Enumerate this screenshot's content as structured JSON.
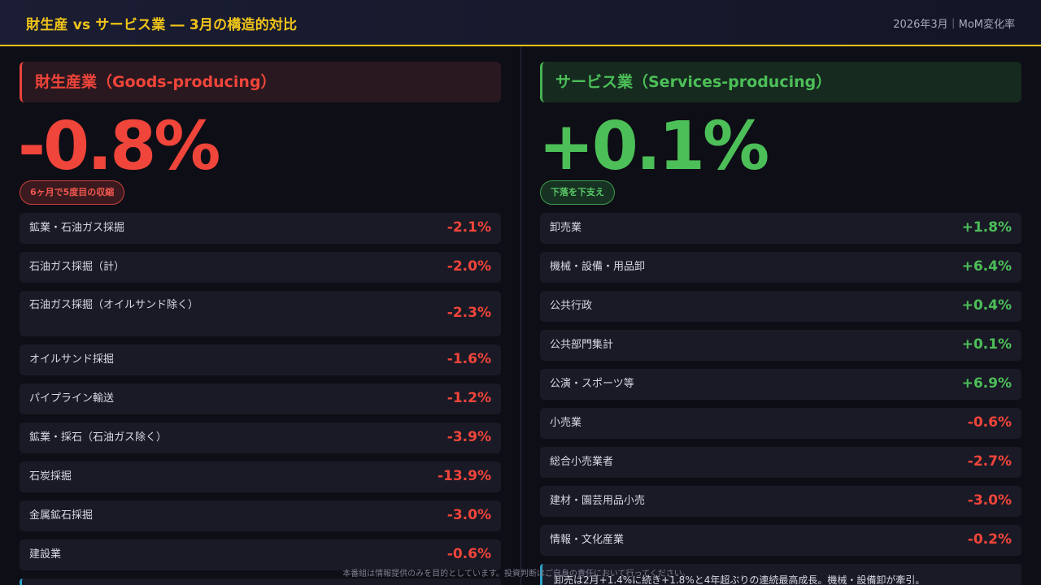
{
  "header": {
    "title": "財生産 vs サービス業 ― 3月の構造的対比",
    "meta": "2026年3月｜MoM変化率"
  },
  "goods": {
    "title": "財生産業（Goods-producing）",
    "value": "-0.8%",
    "badge": "6ヶ月で5度目の収縮",
    "items": [
      {
        "label": "鉱業・石油ガス採掘",
        "value": "-2.1%",
        "dir": "neg"
      },
      {
        "label": "石油ガス採掘（計）",
        "value": "-2.0%",
        "dir": "neg"
      },
      {
        "label": "石油ガス採掘（オイルサンド除く）",
        "value": "-2.3%",
        "dir": "neg"
      },
      {
        "label": "オイルサンド採掘",
        "value": "-1.6%",
        "dir": "neg"
      },
      {
        "label": "パイプライン輸送",
        "value": "-1.2%",
        "dir": "neg"
      },
      {
        "label": "鉱業・採石（石油ガス除く）",
        "value": "-3.9%",
        "dir": "neg"
      },
      {
        "label": "石炭採掘",
        "value": "-13.9%",
        "dir": "neg"
      },
      {
        "label": "金属鉱石採掘",
        "value": "-3.0%",
        "dir": "neg"
      },
      {
        "label": "建設業",
        "value": "-0.6%",
        "dir": "neg"
      }
    ]
  },
  "services": {
    "title": "サービス業（Services-producing）",
    "value": "+0.1%",
    "badge": "下落を下支え",
    "items": [
      {
        "label": "卸売業",
        "value": "+1.8%",
        "dir": "pos"
      },
      {
        "label": "機械・設備・用品卸",
        "value": "+6.4%",
        "dir": "pos"
      },
      {
        "label": "公共行政",
        "value": "+0.4%",
        "dir": "pos"
      },
      {
        "label": "公共部門集計",
        "value": "+0.1%",
        "dir": "pos"
      },
      {
        "label": "公演・スポーツ等",
        "value": "+6.9%",
        "dir": "pos"
      },
      {
        "label": "小売業",
        "value": "-0.6%",
        "dir": "neg"
      },
      {
        "label": "総合小売業者",
        "value": "-2.7%",
        "dir": "neg"
      },
      {
        "label": "建材・園芸用品小売",
        "value": "-3.0%",
        "dir": "neg"
      },
      {
        "label": "情報・文化産業",
        "value": "-0.2%",
        "dir": "neg"
      }
    ]
  },
  "note": "卸売は2月+1.4%に続き+1.8%と4年超ぶりの連続最高成長。機械・設備卸が牽引。",
  "disclaimer": "本番組は情報提供のみを目的としています。投資判断はご自身の責任において行ってください。",
  "colors": {
    "accent": "#f0c419",
    "negative": "#f0453a",
    "positive": "#4cbf58",
    "note_edge": "#2aa3c8"
  }
}
